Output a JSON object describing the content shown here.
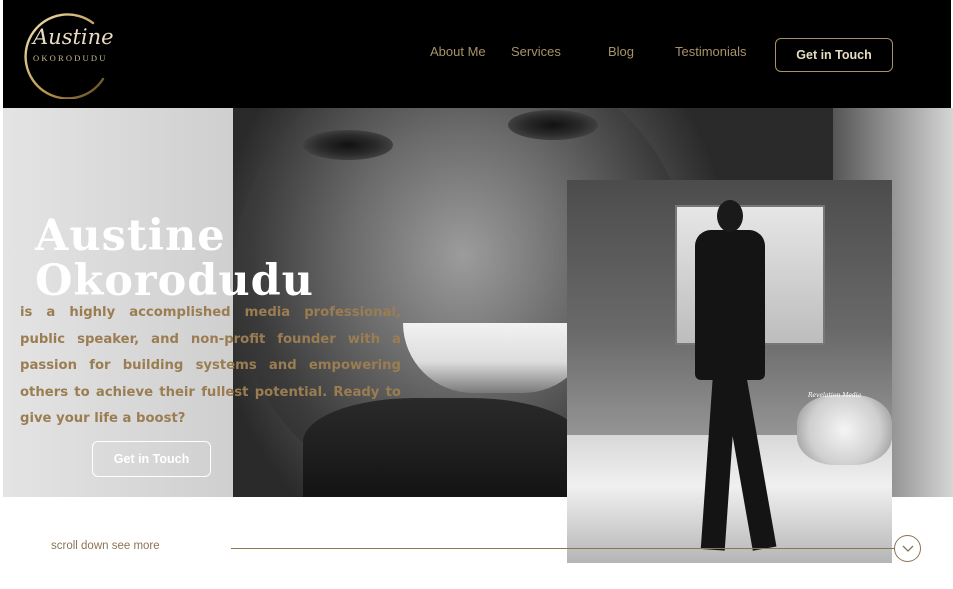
{
  "header": {
    "logo": {
      "script": "Austine",
      "subtitle": "OKORODUDU"
    },
    "nav": [
      {
        "label": "About Me"
      },
      {
        "label": "Services"
      },
      {
        "label": "Blog"
      },
      {
        "label": "Testimonials"
      }
    ],
    "cta_label": "Get in Touch"
  },
  "hero": {
    "name_line1": "Austine",
    "name_line2": "Okorodudu",
    "description": "is a highly accomplished media professional, public speaker, and non-profit founder with a passion for building systems and empowering others to achieve their fullest potential. Ready to give your life a boost?",
    "cta_label": "Get in Touch"
  },
  "photo": {
    "watermark": "Revelation Media"
  },
  "scroll": {
    "label": "scroll down see more",
    "icon": "chevron-down-icon"
  },
  "colors": {
    "accent": "#a8916a",
    "header_bg": "#000000",
    "text_gold": "#9b7d52"
  }
}
